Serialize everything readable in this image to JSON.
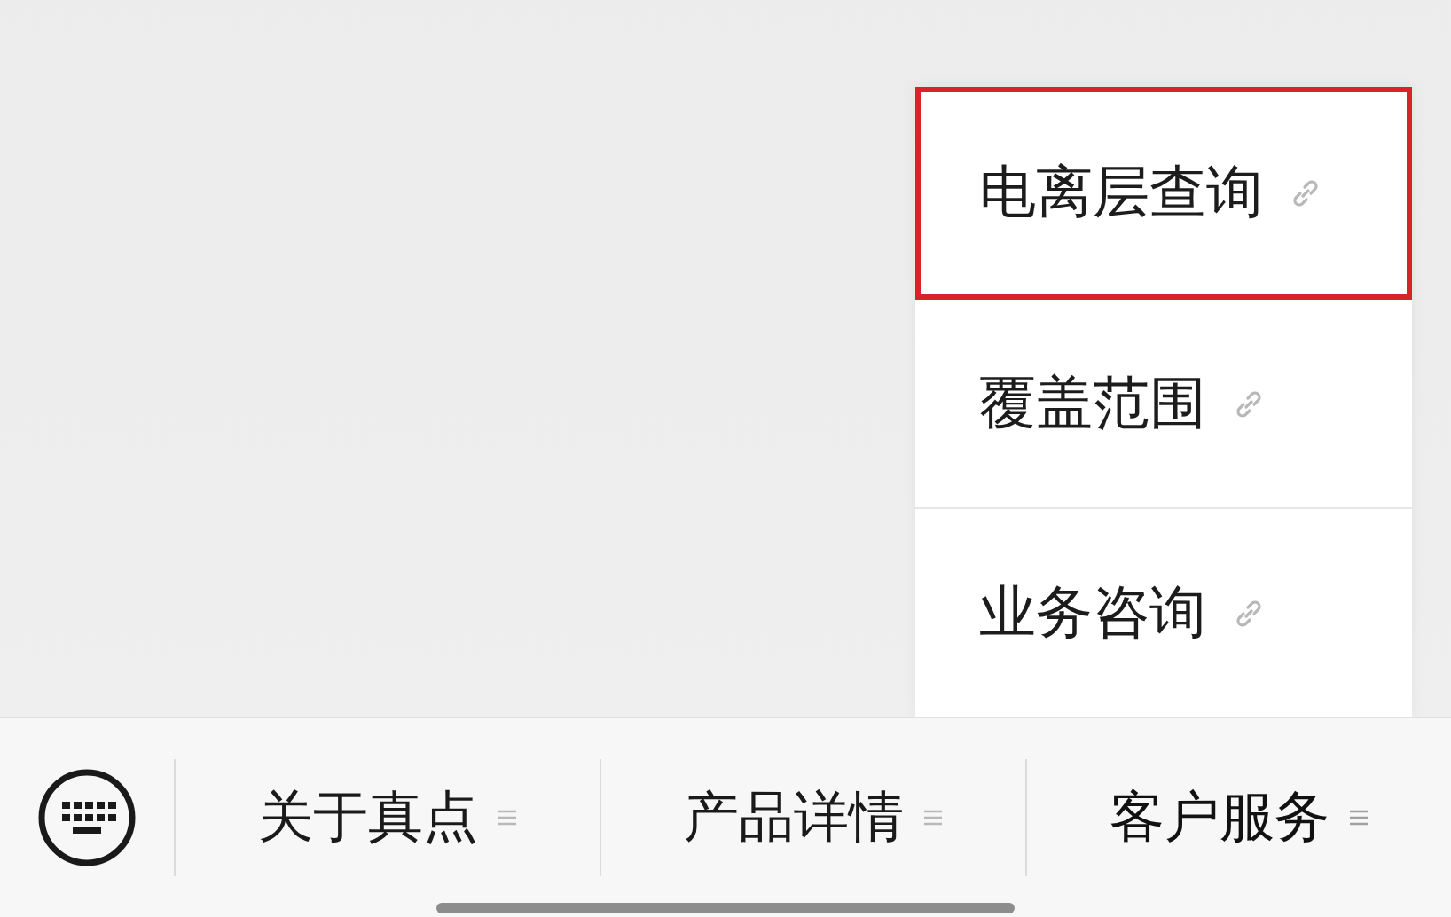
{
  "submenu": {
    "items": [
      {
        "label": "电离层查询",
        "highlighted": true
      },
      {
        "label": "覆盖范围",
        "highlighted": false
      },
      {
        "label": "业务咨询",
        "highlighted": false
      }
    ]
  },
  "menu_bar": {
    "items": [
      {
        "label": "关于真点",
        "expanded": false
      },
      {
        "label": "产品详情",
        "expanded": false
      },
      {
        "label": "客户服务",
        "expanded": true
      }
    ]
  }
}
